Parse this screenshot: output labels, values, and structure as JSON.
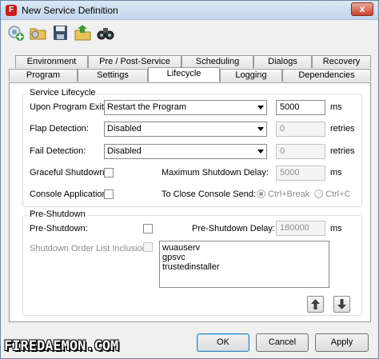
{
  "window": {
    "title": "New Service Definition",
    "app_icon_letter": "F",
    "close_glyph": "x"
  },
  "toolbar": {
    "icons": [
      "add-service-icon",
      "open-folder-icon",
      "save-icon",
      "import-icon",
      "binoculars-icon"
    ]
  },
  "tabs": {
    "row1": [
      "Environment",
      "Pre / Post-Service",
      "Scheduling",
      "Dialogs",
      "Recovery"
    ],
    "row2": [
      "Program",
      "Settings",
      "Lifecycle",
      "Logging",
      "Dependencies"
    ],
    "active": "Lifecycle"
  },
  "lifecycle": {
    "group_title": "Service Lifecycle",
    "upon_exit_label": "Upon Program Exit:",
    "upon_exit_value": "Restart the Program",
    "upon_exit_num": "5000",
    "upon_exit_unit": "ms",
    "flap_label": "Flap Detection:",
    "flap_value": "Disabled",
    "flap_num": "0",
    "flap_unit": "retries",
    "fail_label": "Fail Detection:",
    "fail_value": "Disabled",
    "fail_num": "0",
    "fail_unit": "retries",
    "graceful_label": "Graceful Shutdown:",
    "max_delay_label": "Maximum Shutdown Delay:",
    "max_delay_value": "5000",
    "max_delay_unit": "ms",
    "console_label": "Console Application:",
    "close_console_label": "To Close Console Send:",
    "radio_ctrl_break": "Ctrl+Break",
    "radio_ctrl_c": "Ctrl+C"
  },
  "preshutdown": {
    "group_title": "Pre-Shutdown",
    "pre_label": "Pre-Shutdown:",
    "delay_label": "Pre-Shutdown Delay:",
    "delay_value": "180000",
    "delay_unit": "ms",
    "order_label": "Shutdown Order List Inclusion:",
    "list": [
      "wuauserv",
      "gpsvc",
      "trustedinstaller"
    ]
  },
  "buttons": {
    "ok": "OK",
    "cancel": "Cancel",
    "apply": "Apply"
  },
  "brand": {
    "logo_text": "FIREDAEMON.COM"
  }
}
